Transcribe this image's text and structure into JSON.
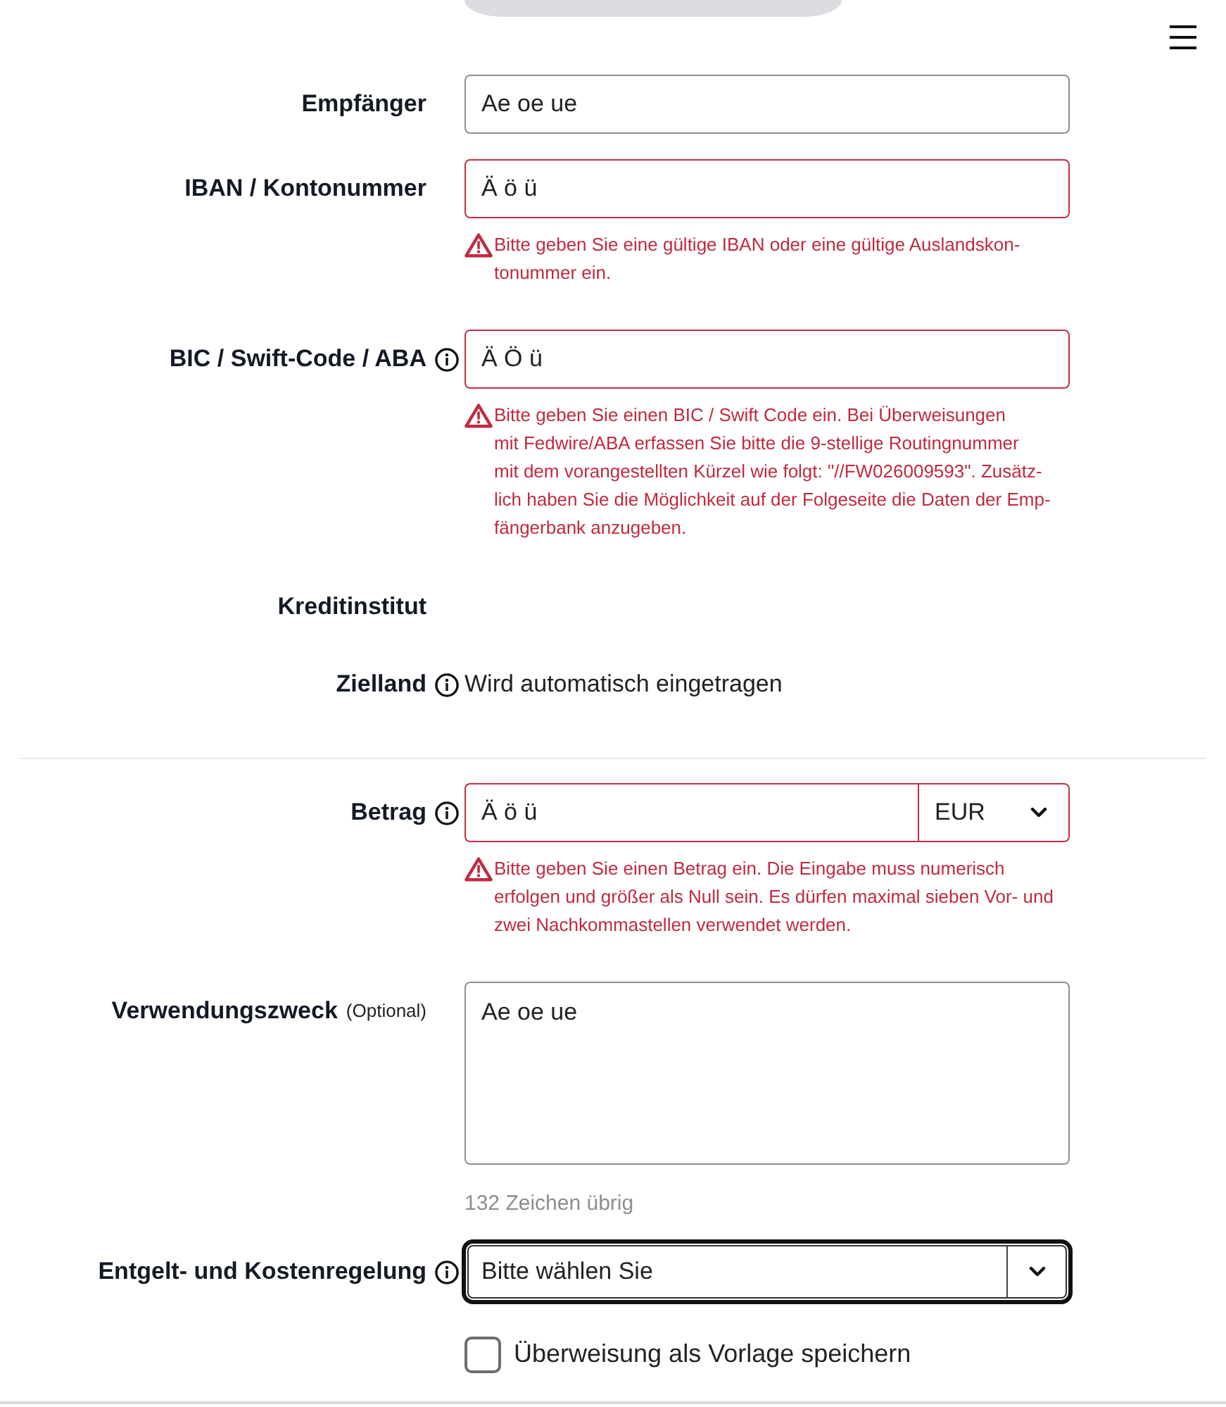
{
  "fields": [
    {
      "kind": "input",
      "label": "Empfänger",
      "info": false,
      "value": "Ae oe ue",
      "invalid": false
    },
    {
      "kind": "input",
      "label": "IBAN / Kontonummer",
      "info": false,
      "value": "Ä ö ü",
      "invalid": true,
      "error": "Bitte geben Sie eine gültige IBAN oder eine gültige Auslandskon-\ntonummer ein."
    },
    {
      "kind": "input",
      "label": "BIC / Swift-Code / ABA",
      "info": true,
      "value": "Ä Ö ü",
      "invalid": true,
      "error": "Bitte geben Sie einen BIC / Swift Code ein. Bei Überweisungen\nmit Fedwire/ABA erfassen Sie bitte die 9-stellige Routingnummer\nmit dem vorangestellten Kürzel wie folgt: \"//FW026009593\". Zusätz-\nlich haben Sie die Möglichkeit auf der Folgeseite die Daten der Emp-\nfängerbank anzugeben."
    },
    {
      "kind": "static",
      "label": "Kreditinstitut",
      "info": false
    },
    {
      "kind": "static",
      "label": "Zielland",
      "info": true,
      "value": "Wird automatisch eingetragen"
    },
    {
      "kind": "divider"
    },
    {
      "kind": "amount",
      "label": "Betrag",
      "info": true,
      "value": "Ä ö ü",
      "currency": "EUR",
      "invalid": true,
      "error": "Bitte geben Sie einen Betrag ein. Die Eingabe muss numerisch\nerfolgen und größer als Null sein. Es dürfen maximal sieben Vor- und\nzwei Nachkommastellen verwendet werden."
    },
    {
      "kind": "textarea",
      "label": "Verwendungszweck",
      "note": "(Optional)",
      "info": false,
      "value": "Ae oe ue",
      "invalid": false,
      "counter": "132 Zeichen übrig"
    },
    {
      "kind": "select",
      "label": "Entgelt- und Kostenregelung",
      "info": true,
      "value": "Bitte wählen Sie",
      "focused": true
    },
    {
      "kind": "checkbox",
      "label": "Überweisung als Vorlage speichern",
      "checked": false
    }
  ]
}
